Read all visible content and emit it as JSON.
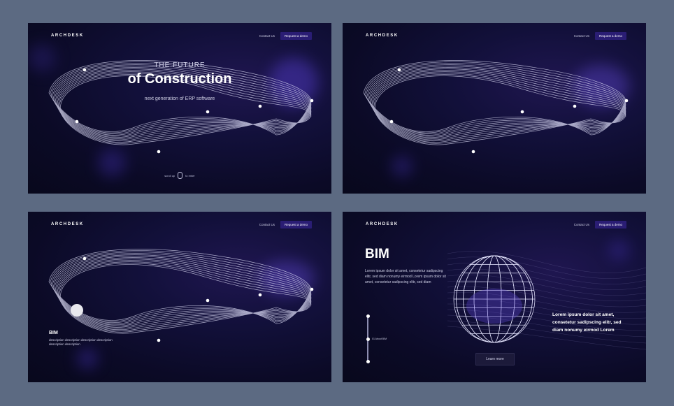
{
  "header": {
    "logo": "ARCHDESK",
    "contact": "Contact Us",
    "demo": "Request a demo"
  },
  "hero": {
    "kicker": "THE FUTURE",
    "title": "of Construction",
    "subtitle": "next generation of ERP software",
    "scroll_before": "scroll up",
    "scroll_after": "to enter"
  },
  "bim_card": {
    "title": "BIM",
    "description": "description description description description description description"
  },
  "bim_section": {
    "title": "BIM",
    "description": "Lorem ipsum dolor sit amet, consetetur sadipscing elitr, sed diam nonumy eirmod Lorem ipsum dolor sit amet, consetetur sadipscing elitr, sed diam",
    "right_text": "Lorem ipsum dolor sit amet, consetetur sadipscing elitr, sed diam nonumy eirmod Lorem",
    "timeline_label": "01 About BIM",
    "learn_more": "Learn more"
  },
  "colors": {
    "page_bg": "#5c6a82",
    "panel_bg": "#0b0a26",
    "accent": "#2a1d74",
    "glow": "#7a5cff"
  }
}
